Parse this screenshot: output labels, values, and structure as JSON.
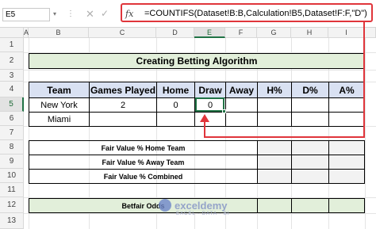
{
  "formula_bar": {
    "name_box": "E5",
    "fx_label": "fx",
    "cancel_icon": "✕",
    "enter_icon": "✓",
    "formula": "=COUNTIFS(Dataset!B:B,Calculation!B5,Dataset!F:F,\"D\")"
  },
  "columns": [
    "A",
    "B",
    "C",
    "D",
    "E",
    "F",
    "G",
    "H",
    "I"
  ],
  "rows": [
    "1",
    "2",
    "3",
    "4",
    "5",
    "6",
    "7",
    "8",
    "9",
    "10",
    "11",
    "12",
    "13"
  ],
  "title": "Creating Betting Algorithm",
  "table": {
    "headers": [
      "Team",
      "Games Played",
      "Home",
      "Draw",
      "Away",
      "H%",
      "D%",
      "A%"
    ],
    "row5": [
      "New York",
      "2",
      "0",
      "0",
      "",
      "",
      "",
      ""
    ],
    "row6": [
      "Miami",
      "",
      "",
      "",
      "",
      "",
      "",
      ""
    ]
  },
  "fair_values": {
    "home": "Fair Value % Home Team",
    "away": "Fair Value % Away Team",
    "combined": "Fair Value % Combined"
  },
  "betfair": "Betfair Odds",
  "watermark": {
    "brand": "exceldemy",
    "tagline": "EXCEL · DATA · BI"
  },
  "colors": {
    "accent_red": "#e0353b",
    "excel_green": "#217346",
    "header_blue": "#d9e1f2",
    "title_green": "#e2efda"
  }
}
